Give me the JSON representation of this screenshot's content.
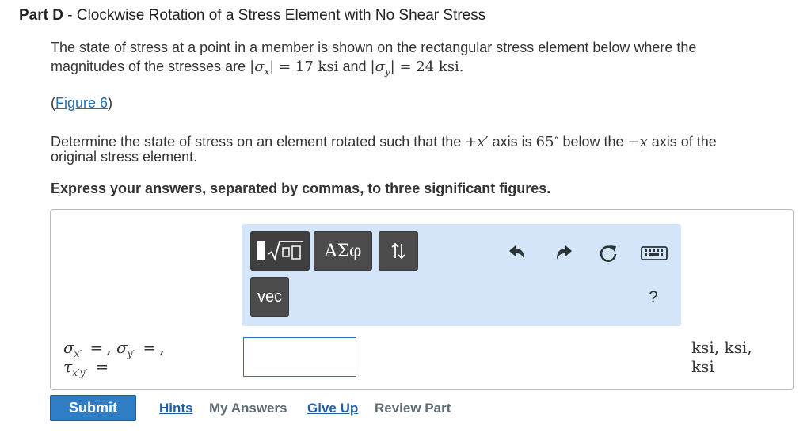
{
  "part": {
    "label": "Part D",
    "separator": " - ",
    "title": "Clockwise Rotation of a Stress Element with No Shear Stress"
  },
  "problem": {
    "intro_1": "The state of stress at a point in a member is shown on the rectangular stress element below where the",
    "intro_2a": "magnitudes of the stresses are ",
    "intro_2b": " and ",
    "sigma_x_value": "= 17 ksi",
    "sigma_y_value": "= 24 ksi.",
    "figure_link": "Figure 6",
    "task_1a": "Determine the state of stress on an element rotated such that the ",
    "task_1b": " axis is ",
    "task_angle": "65",
    "task_1c": " below the ",
    "task_1d": " axis of the",
    "task_2": "original stress element.",
    "instruction": "Express your answers, separated by commas, to three significant figures."
  },
  "toolbar": {
    "greek_label": "ΑΣφ",
    "vec_label": "vec",
    "help_label": "?"
  },
  "answer": {
    "input_value": "",
    "units_line1": "ksi, ksi,",
    "units_line2": "ksi"
  },
  "actions": {
    "submit": "Submit",
    "hints": "Hints",
    "my_answers": "My Answers",
    "give_up": "Give Up",
    "review_part": "Review Part"
  },
  "colors": {
    "toolbar_bg": "#d4e5f9",
    "button_dark": "#4b4b4b",
    "submit_blue": "#2f7dc4",
    "link_blue": "#1f6fb2"
  }
}
